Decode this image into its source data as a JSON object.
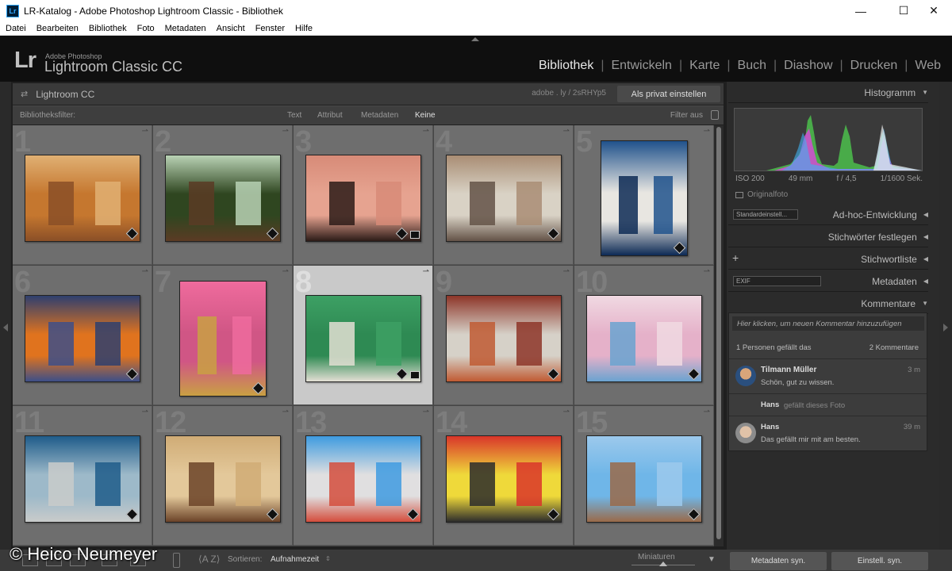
{
  "window": {
    "title": "LR-Katalog - Adobe Photoshop Lightroom Classic - Bibliothek",
    "app_icon": "Lr"
  },
  "menu": [
    "Datei",
    "Bearbeiten",
    "Bibliothek",
    "Foto",
    "Metadaten",
    "Ansicht",
    "Fenster",
    "Hilfe"
  ],
  "branding": {
    "logo": "Lr",
    "small": "Adobe Photoshop",
    "big": "Lightroom Classic CC"
  },
  "modules": [
    {
      "label": "Bibliothek",
      "active": true
    },
    {
      "label": "Entwickeln",
      "active": false
    },
    {
      "label": "Karte",
      "active": false
    },
    {
      "label": "Buch",
      "active": false
    },
    {
      "label": "Diashow",
      "active": false
    },
    {
      "label": "Drucken",
      "active": false
    },
    {
      "label": "Web",
      "active": false
    }
  ],
  "collection": {
    "name": "Lightroom CC",
    "shortlink": "adobe . ly / 2sRHYp5",
    "private_button": "Als privat einstellen"
  },
  "filter": {
    "label": "Bibliotheksfilter:",
    "options": [
      "Text",
      "Attribut",
      "Metadaten",
      "Keine"
    ],
    "active": "Keine",
    "filter_off": "Filter aus"
  },
  "grid": {
    "selected": 8,
    "cells": [
      {
        "n": "1",
        "colors": [
          "#c5772f",
          "#e0b073",
          "#8a4f27"
        ]
      },
      {
        "n": "2",
        "colors": [
          "#2f4620",
          "#b9d2b5",
          "#5b3b24"
        ]
      },
      {
        "n": "3",
        "colors": [
          "#e6a390",
          "#d78b78",
          "#2b1b17"
        ]
      },
      {
        "n": "4",
        "colors": [
          "#d9d2c5",
          "#a98d74",
          "#635247"
        ]
      },
      {
        "n": "5",
        "colors": [
          "#e8e6e1",
          "#20528c",
          "#0d2a55"
        ]
      },
      {
        "n": "6",
        "colors": [
          "#e0731e",
          "#2e3f6f",
          "#3d4f88"
        ]
      },
      {
        "n": "7",
        "colors": [
          "#d05685",
          "#ef6b9d",
          "#c9a043"
        ]
      },
      {
        "n": "8",
        "colors": [
          "#2e8a53",
          "#3da064",
          "#e3dfd4"
        ]
      },
      {
        "n": "9",
        "colors": [
          "#d6d1c8",
          "#8d3528",
          "#c05a32"
        ]
      },
      {
        "n": "10",
        "colors": [
          "#e5b1c9",
          "#f0d9e2",
          "#6aa3d0"
        ]
      },
      {
        "n": "11",
        "colors": [
          "#9db9c9",
          "#1f5c8a",
          "#c9cbca"
        ]
      },
      {
        "n": "12",
        "colors": [
          "#e3c89a",
          "#d0ac76",
          "#6b4328"
        ]
      },
      {
        "n": "13",
        "colors": [
          "#e0dfe0",
          "#3e9be0",
          "#d44d3c"
        ]
      },
      {
        "n": "14",
        "colors": [
          "#efd93a",
          "#d9352a",
          "#2c2c2c"
        ]
      },
      {
        "n": "15",
        "colors": [
          "#6fb6e8",
          "#9cc9ec",
          "#9a6a49"
        ]
      }
    ]
  },
  "histogram": {
    "title": "Histogramm",
    "iso": "ISO 200",
    "focal": "49 mm",
    "aperture": "f / 4,5",
    "shutter": "1/1600 Sek.",
    "original": "Originalfoto"
  },
  "panels": {
    "adhoc": "Ad-hoc-Entwicklung",
    "adhoc_preset": "Standardeinstell...",
    "keywords_set": "Stichwörter festlegen",
    "keyword_list": "Stichwortliste",
    "metadata": "Metadaten",
    "metadata_preset": "EXIF",
    "comments": "Kommentare"
  },
  "comments": {
    "placeholder": "Hier klicken, um neuen Kommentar hinzuzufügen",
    "likes": "1 Personen gefällt das",
    "count": "2 Kommentare",
    "items": [
      {
        "name": "Tilmann Müller",
        "text": "Schön, gut zu wissen.",
        "time": "3 m"
      },
      {
        "name": "Hans",
        "text": "gefällt dieses Foto",
        "time": ""
      },
      {
        "name": "Hans",
        "text": "Das gefällt mir mit am besten.",
        "time": "39 m"
      }
    ]
  },
  "toolbar": {
    "sort_label": "Sortieren:",
    "sort_value": "Aufnahmezeit",
    "thumbs_label": "Miniaturen",
    "sync_meta": "Metadaten syn.",
    "sync_settings": "Einstell. syn."
  },
  "watermark": "© Heico Neumeyer"
}
